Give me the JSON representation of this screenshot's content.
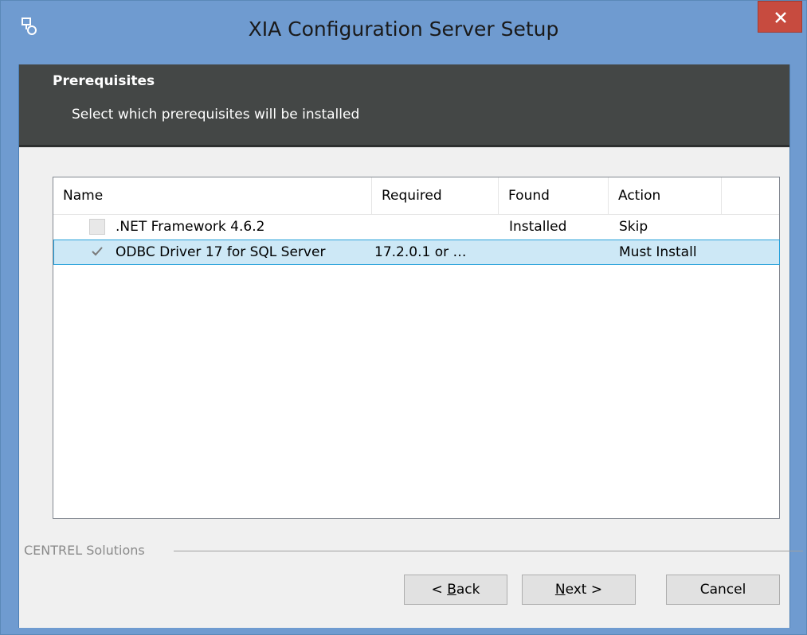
{
  "window": {
    "title": "XIA Configuration Server Setup"
  },
  "banner": {
    "title": "Prerequisites",
    "subtitle": "Select which prerequisites will be installed"
  },
  "list": {
    "columns": [
      "Name",
      "Required",
      "Found",
      "Action"
    ],
    "rows": [
      {
        "checked": false,
        "name": ".NET Framework 4.6.2",
        "required": "",
        "found": "Installed",
        "action": "Skip"
      },
      {
        "checked": true,
        "selected": true,
        "name": "ODBC Driver 17 for SQL Server",
        "required": "17.2.0.1 or …",
        "found": "",
        "action": "Must Install"
      }
    ]
  },
  "footer": {
    "brand": "CENTREL Solutions",
    "back_prefix": "< ",
    "back_mnemonic": "B",
    "back_rest": "ack",
    "next_mnemonic": "N",
    "next_rest": "ext >",
    "cancel_label": "Cancel"
  },
  "colors": {
    "titlebar": "#6f9bd0",
    "banner": "#444746",
    "close": "#c74b3f",
    "selection": "#cde8f6"
  },
  "icons": [
    "setup-app-icon",
    "close-icon",
    "checkbox-unchecked-icon",
    "checkmark-icon"
  ]
}
